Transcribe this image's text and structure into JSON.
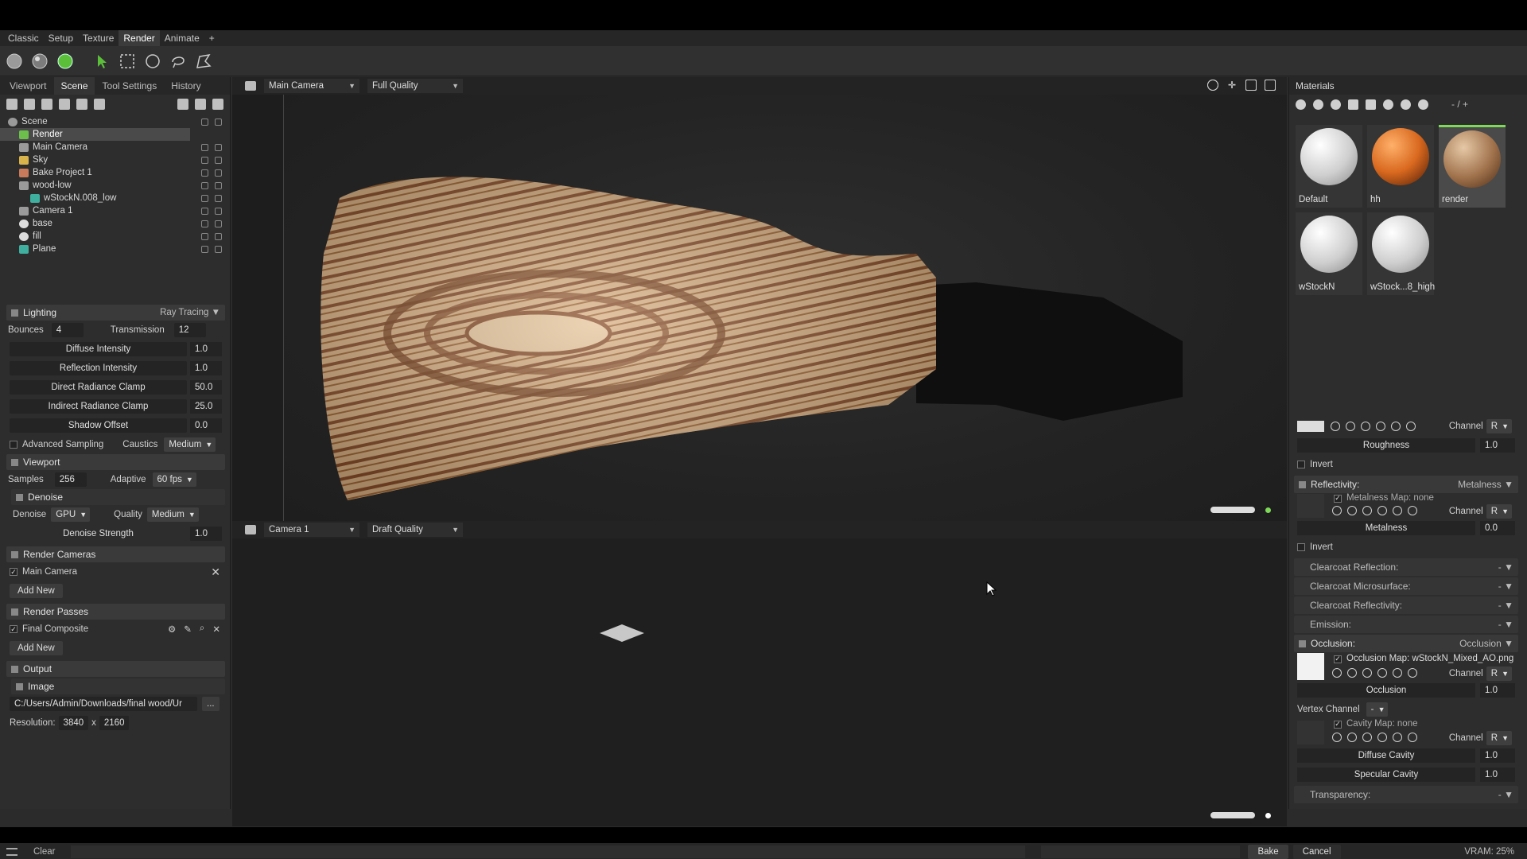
{
  "menu": {
    "tabs": [
      "Classic",
      "Setup",
      "Texture",
      "Render",
      "Animate",
      "+"
    ],
    "active": "Render"
  },
  "left": {
    "tabs": [
      "Viewport",
      "Scene",
      "Tool Settings",
      "History"
    ],
    "active_tab": "Scene",
    "scene_tree": [
      {
        "label": "Scene",
        "indent": 0
      },
      {
        "label": "Render",
        "indent": 1
      },
      {
        "label": "Main Camera",
        "indent": 1
      },
      {
        "label": "Sky",
        "indent": 1
      },
      {
        "label": "Bake Project 1",
        "indent": 1
      },
      {
        "label": "wood-low",
        "indent": 1
      },
      {
        "label": "wStockN.008_low",
        "indent": 2
      },
      {
        "label": "Camera 1",
        "indent": 1
      },
      {
        "label": "base",
        "indent": 1
      },
      {
        "label": "fill",
        "indent": 1
      },
      {
        "label": "Plane",
        "indent": 1
      }
    ],
    "lighting": {
      "title": "Lighting",
      "mode": "Ray Tracing",
      "bounces_label": "Bounces",
      "bounces": "4",
      "transmission_label": "Transmission",
      "transmission": "12",
      "sliders": [
        {
          "label": "Diffuse Intensity",
          "value": "1.0"
        },
        {
          "label": "Reflection Intensity",
          "value": "1.0"
        },
        {
          "label": "Direct Radiance Clamp",
          "value": "50.0"
        },
        {
          "label": "Indirect Radiance Clamp",
          "value": "25.0"
        },
        {
          "label": "Shadow Offset",
          "value": "0.0"
        }
      ],
      "advanced_sampling": "Advanced Sampling",
      "caustics_label": "Caustics",
      "caustics": "Medium"
    },
    "viewport": {
      "title": "Viewport",
      "samples_label": "Samples",
      "samples": "256",
      "adaptive_label": "Adaptive",
      "adaptive": "60 fps",
      "denoise_title": "Denoise",
      "denoise_label": "Denoise",
      "denoise": "GPU",
      "quality_label": "Quality",
      "quality": "Medium",
      "strength_label": "Denoise Strength",
      "strength": "1.0"
    },
    "render_cameras": {
      "title": "Render Cameras",
      "item": "Main Camera",
      "add": "Add New"
    },
    "render_passes": {
      "title": "Render Passes",
      "item": "Final Composite",
      "add": "Add New"
    },
    "output": {
      "title": "Output",
      "image": "Image",
      "path": "C:/Users/Admin/Downloads/final wood/Ur",
      "browse": "...",
      "resolution_label": "Resolution:",
      "width": "3840",
      "x": "x",
      "height": "2160"
    }
  },
  "viewport": {
    "top": {
      "camera": "Main Camera",
      "quality": "Full Quality"
    },
    "bottom": {
      "camera": "Camera 1",
      "quality": "Draft Quality"
    }
  },
  "materials": {
    "title": "Materials",
    "counter": "- / +",
    "items": [
      {
        "name": "Default",
        "color": "#f2f2f2"
      },
      {
        "name": "hh",
        "color": "#d9691f"
      },
      {
        "name": "render",
        "color": "#a0724c"
      },
      {
        "name": "wStockN",
        "color": "#f2f2f2"
      },
      {
        "name": "wStock...8_high",
        "color": "#f2f2f2"
      }
    ],
    "selected": "render"
  },
  "props": {
    "channel_label": "Channel",
    "channel": "R",
    "roughness_label": "Roughness",
    "roughness": "1.0",
    "invert": "Invert",
    "reflectivity_title": "Reflectivity:",
    "reflectivity_mode": "Metalness",
    "metalness_map": "Metalness Map: none",
    "metalness_label": "Metalness",
    "metalness": "0.0",
    "clearcoat_reflection": "Clearcoat Reflection:",
    "clearcoat_microsurface": "Clearcoat Microsurface:",
    "clearcoat_reflectivity": "Clearcoat Reflectivity:",
    "emission": "Emission:",
    "dash": "-",
    "occlusion_title": "Occlusion:",
    "occlusion_mode": "Occlusion",
    "occlusion_map": "Occlusion Map: wStockN_Mixed_AO.png",
    "occlusion_label": "Occlusion",
    "occlusion": "1.0",
    "vertex_channel_label": "Vertex Channel",
    "vertex_channel": "-",
    "cavity_map": "Cavity Map: none",
    "diffuse_cavity_label": "Diffuse Cavity",
    "diffuse_cavity": "1.0",
    "specular_cavity_label": "Specular Cavity",
    "specular_cavity": "1.0",
    "transparency": "Transparency:"
  },
  "status": {
    "clear": "Clear",
    "bake": "Bake",
    "cancel": "Cancel",
    "vram": "VRAM: 25%"
  }
}
